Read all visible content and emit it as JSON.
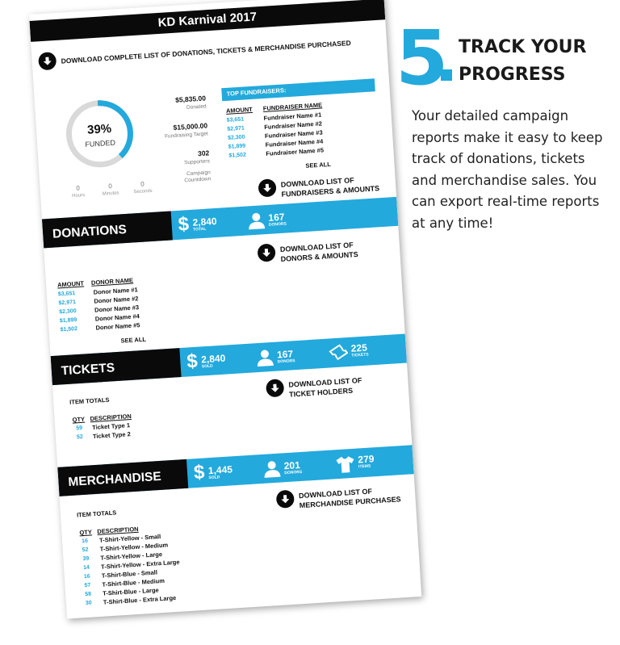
{
  "step": {
    "number": "5",
    "title_line1": "TRACK YOUR",
    "title_line2": "PROGRESS",
    "description": "Your detailed campaign reports make it easy to keep track of donations, tickets and merchandise sales. You can export real-time reports at any time!"
  },
  "report": {
    "title": "KD Karnival 2017",
    "download_all": "DOWNLOAD COMPLETE LIST OF DONATIONS, TICKETS & MERCHANDISE PURCHASED",
    "funded_percent": "39%",
    "funded_fraction": 0.39,
    "funded_label": "FUNDED",
    "donated_value": "$5,835.00",
    "donated_label": "Donated",
    "target_value": "$15,000.00",
    "target_label": "Fundraising Target",
    "supporters_value": "302",
    "supporters_label": "Supporters",
    "countdown_label_1": "Campaign",
    "countdown_label_2": "Countdown",
    "countdown": [
      {
        "num": "0",
        "label": "Hours"
      },
      {
        "num": "0",
        "label": "Minutes"
      },
      {
        "num": "0",
        "label": "Seconds"
      }
    ],
    "top_fundraisers": {
      "header": "TOP FUNDRAISERS:",
      "col_amount": "AMOUNT",
      "col_name": "FUNDRAISER NAME",
      "rows": [
        {
          "amount": "$3,651",
          "name": "Fundraiser Name #1"
        },
        {
          "amount": "$2,971",
          "name": "Fundraiser Name #2"
        },
        {
          "amount": "$2,300",
          "name": "Fundraiser Name #3"
        },
        {
          "amount": "$1,899",
          "name": "Fundraiser Name #4"
        },
        {
          "amount": "$1,502",
          "name": "Fundraiser Name #5"
        }
      ],
      "see_all": "SEE ALL",
      "download_1": "DOWNLOAD LIST OF",
      "download_2": "FUNDRAISERS & AMOUNTS"
    },
    "donations": {
      "label": "DONATIONS",
      "total_value": "2,840",
      "total_label": "TOTAL",
      "donors_value": "167",
      "donors_label": "DONORS",
      "download_1": "DOWNLOAD LIST OF",
      "download_2": "DONORS & AMOUNTS",
      "col_amount": "AMOUNT",
      "col_name": "DONOR NAME",
      "rows": [
        {
          "amount": "$3,651",
          "name": "Donor Name #1"
        },
        {
          "amount": "$2,971",
          "name": "Donor Name #2"
        },
        {
          "amount": "$2,300",
          "name": "Donor Name #3"
        },
        {
          "amount": "$1,899",
          "name": "Donor Name #4"
        },
        {
          "amount": "$1,502",
          "name": "Donor Name #5"
        }
      ],
      "see_all": "SEE ALL"
    },
    "tickets": {
      "label": "TICKETS",
      "sold_value": "2,840",
      "sold_label": "SOLD",
      "donors_value": "167",
      "donors_label": "DONORS",
      "tickets_value": "225",
      "tickets_label": "TICKETS",
      "item_totals": "ITEM TOTALS",
      "download_1": "DOWNLOAD LIST OF",
      "download_2": "TICKET HOLDERS",
      "col_qty": "QTY",
      "col_desc": "DESCRIPTION",
      "rows": [
        {
          "qty": "59",
          "desc": "Ticket Type 1"
        },
        {
          "qty": "52",
          "desc": "Ticket Type 2"
        }
      ]
    },
    "merchandise": {
      "label": "MERCHANDISE",
      "sold_value": "1,445",
      "sold_label": "SOLD",
      "donors_value": "201",
      "donors_label": "DONORS",
      "items_value": "279",
      "items_label": "ITEMS",
      "item_totals": "ITEM TOTALS",
      "download_1": "DOWNLOAD LIST OF",
      "download_2": "MERCHANDISE PURCHASES",
      "col_qty": "QTY",
      "col_desc": "DESCRIPTION",
      "rows": [
        {
          "qty": "16",
          "desc": "T-Shirt-Yellow - Small"
        },
        {
          "qty": "52",
          "desc": "T-Shirt-Yellow - Medium"
        },
        {
          "qty": "39",
          "desc": "T-Shirt-Yellow - Large"
        },
        {
          "qty": "14",
          "desc": "T-Shirt-Yellow - Extra Large"
        },
        {
          "qty": "16",
          "desc": "T-Shirt-Blue - Small"
        },
        {
          "qty": "57",
          "desc": "T-Shirt-Blue - Medium"
        },
        {
          "qty": "58",
          "desc": "T-Shirt-Blue - Large"
        },
        {
          "qty": "30",
          "desc": "T-Shirt-Blue - Extra Large"
        }
      ]
    }
  },
  "colors": {
    "accent": "#23a9dc",
    "dark": "#0a0a0a"
  },
  "icons": [
    "download-icon",
    "dollar-icon",
    "person-icon",
    "ticket-icon",
    "tshirt-icon"
  ]
}
